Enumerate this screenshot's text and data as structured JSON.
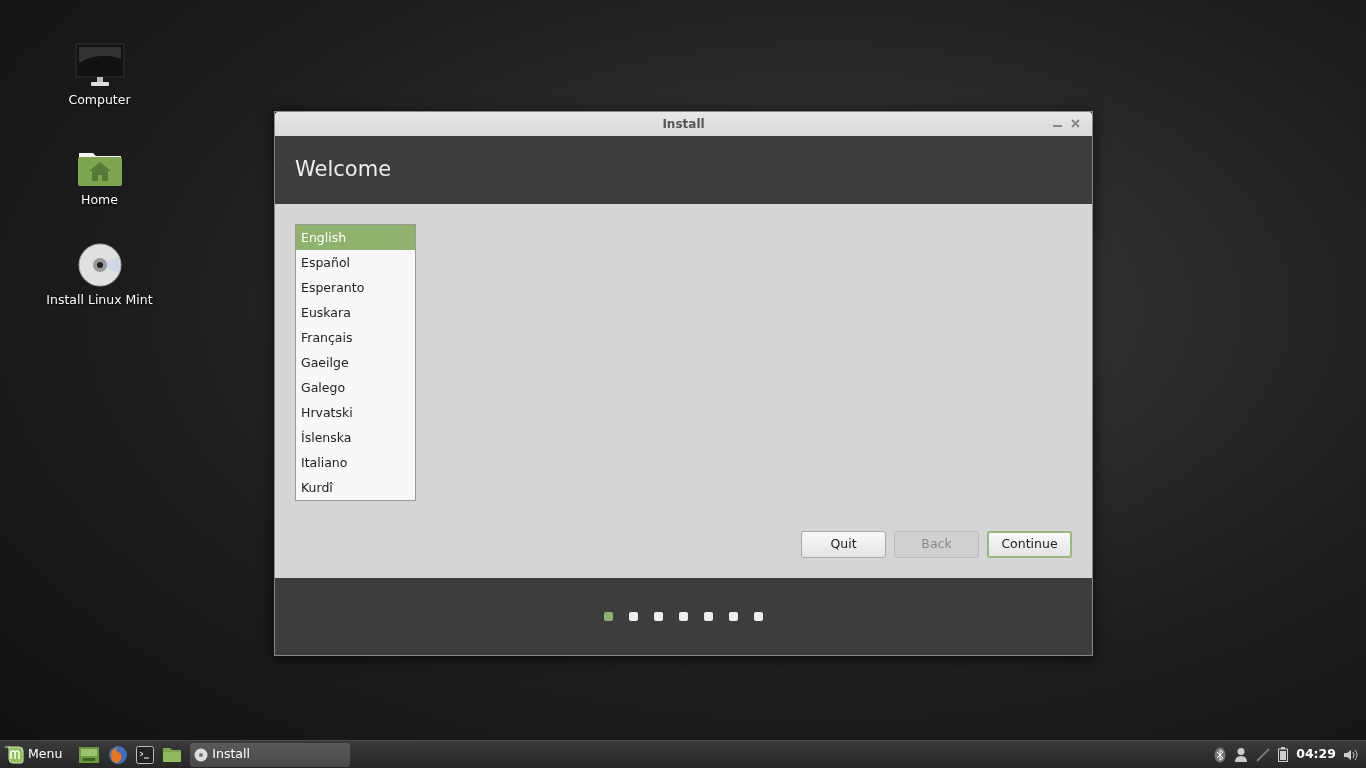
{
  "desktop_icons": [
    {
      "label": "Computer",
      "kind": "computer"
    },
    {
      "label": "Home",
      "kind": "home"
    },
    {
      "label": "Install Linux Mint",
      "kind": "disc"
    }
  ],
  "window": {
    "title": "Install",
    "heading": "Welcome",
    "languages": [
      {
        "label": "English",
        "selected": true
      },
      {
        "label": "Español",
        "selected": false
      },
      {
        "label": "Esperanto",
        "selected": false
      },
      {
        "label": "Euskara",
        "selected": false
      },
      {
        "label": "Français",
        "selected": false
      },
      {
        "label": "Gaeilge",
        "selected": false
      },
      {
        "label": "Galego",
        "selected": false
      },
      {
        "label": "Hrvatski",
        "selected": false
      },
      {
        "label": "Íslenska",
        "selected": false
      },
      {
        "label": "Italiano",
        "selected": false
      },
      {
        "label": "Kurdî",
        "selected": false
      }
    ],
    "buttons": [
      {
        "label": "Quit",
        "disabled": false,
        "default": false
      },
      {
        "label": "Back",
        "disabled": true,
        "default": false
      },
      {
        "label": "Continue",
        "disabled": false,
        "default": true
      }
    ],
    "steps": [
      {
        "selected": true
      },
      {
        "selected": false
      },
      {
        "selected": false
      },
      {
        "selected": false
      },
      {
        "selected": false
      },
      {
        "selected": false
      },
      {
        "selected": false
      }
    ]
  },
  "taskbar": {
    "menu_label": "Menu",
    "launchers": [
      {
        "kind": "files"
      },
      {
        "kind": "browser"
      },
      {
        "kind": "terminal"
      },
      {
        "kind": "folder"
      }
    ],
    "tasks": [
      {
        "label": "Install"
      }
    ],
    "clock": "04:29"
  }
}
